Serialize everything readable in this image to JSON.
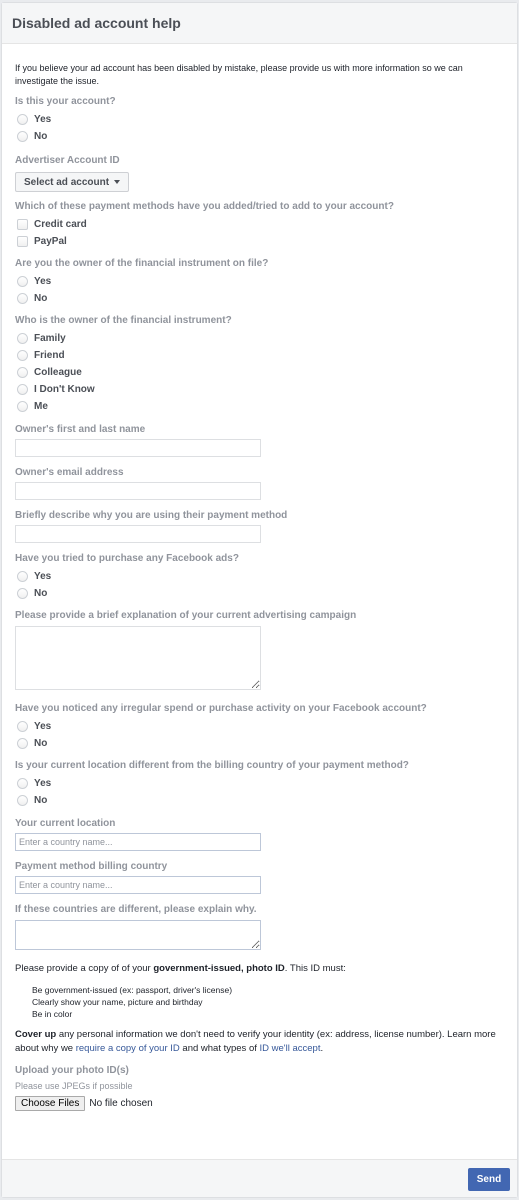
{
  "header": {
    "title": "Disabled ad account help"
  },
  "intro": "If you believe your ad account has been disabled by mistake, please provide us with more information so we can investigate the issue.",
  "q_own_account": {
    "label": "Is this your account?",
    "options": [
      "Yes",
      "No"
    ]
  },
  "advertiser_id": {
    "label": "Advertiser Account ID",
    "select_label": "Select ad account"
  },
  "payment_methods": {
    "label": "Which of these payment methods have you added/tried to add to your account?",
    "options": [
      "Credit card",
      "PayPal"
    ]
  },
  "q_owner_instrument": {
    "label": "Are you the owner of the financial instrument on file?",
    "options": [
      "Yes",
      "No"
    ]
  },
  "q_who_owner": {
    "label": "Who is the owner of the financial instrument?",
    "options": [
      "Family",
      "Friend",
      "Colleague",
      "I Don't Know",
      "Me"
    ]
  },
  "owner_name": {
    "label": "Owner's first and last name",
    "value": "",
    "placeholder": ""
  },
  "owner_email": {
    "label": "Owner's email address",
    "value": "",
    "placeholder": ""
  },
  "why_using": {
    "label": "Briefly describe why you are using their payment method",
    "value": "",
    "placeholder": ""
  },
  "q_purchase_ads": {
    "label": "Have you tried to purchase any Facebook ads?",
    "options": [
      "Yes",
      "No"
    ]
  },
  "campaign_explanation": {
    "label": "Please provide a brief explanation of your current advertising campaign",
    "value": ""
  },
  "q_irregular": {
    "label": "Have you noticed any irregular spend or purchase activity on your Facebook account?",
    "options": [
      "Yes",
      "No"
    ]
  },
  "q_location_diff": {
    "label": "Is your current location different from the billing country of your payment method?",
    "options": [
      "Yes",
      "No"
    ]
  },
  "current_location": {
    "label": "Your current location",
    "placeholder": "Enter a country name..."
  },
  "billing_country": {
    "label": "Payment method billing country",
    "placeholder": "Enter a country name..."
  },
  "countries_explain": {
    "label": "If these countries are different, please explain why.",
    "value": ""
  },
  "id_section": {
    "text_before": "Please provide a copy of of your ",
    "text_bold": "government-issued, photo ID",
    "text_after": ". This ID must:",
    "requirements": [
      "Be government-issued (ex: passport, driver's license)",
      "Clearly show your name, picture and birthday",
      "Be in color"
    ],
    "cover_bold": "Cover up",
    "cover_text": " any personal information we don't need to verify your identity (ex: address, license number). Learn more about why we ",
    "link_require": "require a copy of your ID",
    "cover_mid": " and what types of ",
    "link_accept": "ID we'll accept",
    "cover_end": "."
  },
  "upload": {
    "label": "Upload your photo ID(s)",
    "hint": "Please use JPEGs if possible",
    "button": "Choose Files",
    "status": "No file chosen"
  },
  "footer": {
    "send_label": "Send"
  },
  "colors": {
    "primary": "#4267b2",
    "link": "#365899",
    "label_gray": "#90949c",
    "header_bg": "#f5f6f7"
  }
}
